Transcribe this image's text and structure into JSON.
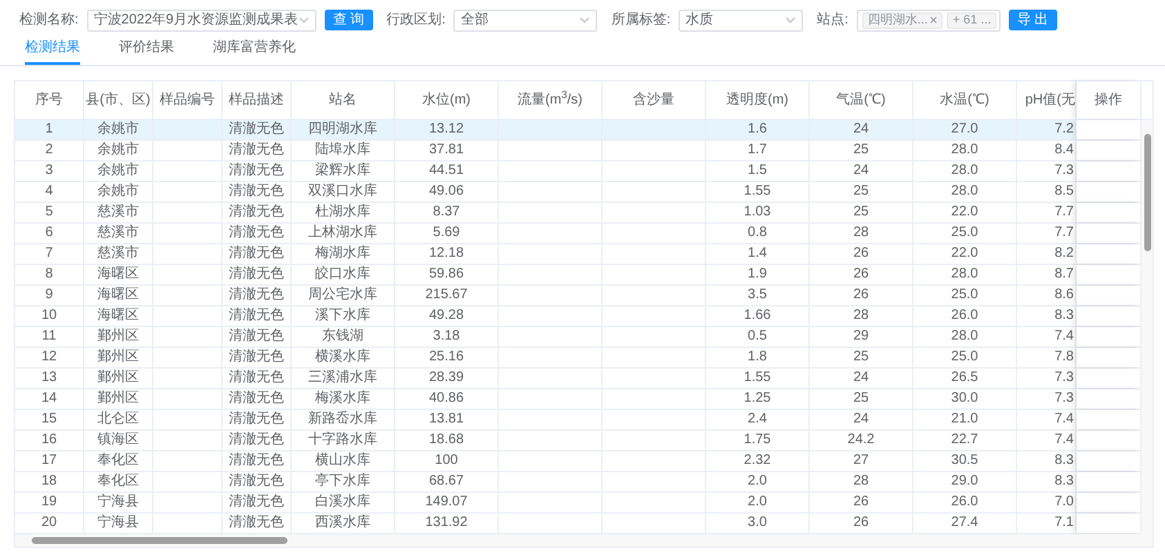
{
  "filters": [
    {
      "kind": "select",
      "label": "检测名称:",
      "value": "宁波2022年9月水资源监测成果表"
    },
    {
      "kind": "button",
      "label": "查 询"
    },
    {
      "kind": "select",
      "label": "行政区划:",
      "value": "全部"
    },
    {
      "kind": "select",
      "label": "所属标签:",
      "value": "水质"
    },
    {
      "kind": "tags",
      "label": "站点:",
      "tags": [
        {
          "text": "四明湖水...",
          "removable": true
        },
        {
          "text": "+ 61 ...",
          "removable": false
        }
      ]
    },
    {
      "kind": "button",
      "label": "导 出"
    }
  ],
  "tabs": [
    {
      "label": "检测结果",
      "selected": true
    },
    {
      "label": "评价结果",
      "selected": false
    },
    {
      "label": "湖库富营养化",
      "selected": false
    }
  ],
  "table": {
    "columns": [
      "序号",
      "县(市、区)",
      "样品编号",
      "样品描述",
      "站名",
      "水位(m)",
      "流量(m$^{3}$/s)",
      "含沙量",
      "透明度(m)",
      "气温(℃)",
      "水温(℃)",
      "pH值(无",
      "操作"
    ],
    "rows": [
      {
        "no": "1",
        "county": "余姚市",
        "desc": "清澈无色",
        "station": "四明湖水库",
        "level": "13.12",
        "clarity": "1.6",
        "air": "24",
        "water": "27.0",
        "ph": "7.2",
        "selected": true
      },
      {
        "no": "2",
        "county": "余姚市",
        "desc": "清澈无色",
        "station": "陆埠水库",
        "level": "37.81",
        "clarity": "1.7",
        "air": "25",
        "water": "28.0",
        "ph": "8.4",
        "selected": false
      },
      {
        "no": "3",
        "county": "余姚市",
        "desc": "清澈无色",
        "station": "梁辉水库",
        "level": "44.51",
        "clarity": "1.5",
        "air": "24",
        "water": "28.0",
        "ph": "7.3",
        "selected": false
      },
      {
        "no": "4",
        "county": "余姚市",
        "desc": "清澈无色",
        "station": "双溪口水库",
        "level": "49.06",
        "clarity": "1.55",
        "air": "25",
        "water": "28.0",
        "ph": "8.5",
        "selected": false
      },
      {
        "no": "5",
        "county": "慈溪市",
        "desc": "清澈无色",
        "station": "杜湖水库",
        "level": "8.37",
        "clarity": "1.03",
        "air": "25",
        "water": "22.0",
        "ph": "7.7",
        "selected": false
      },
      {
        "no": "6",
        "county": "慈溪市",
        "desc": "清澈无色",
        "station": "上林湖水库",
        "level": "5.69",
        "clarity": "0.8",
        "air": "28",
        "water": "25.0",
        "ph": "7.7",
        "selected": false
      },
      {
        "no": "7",
        "county": "慈溪市",
        "desc": "清澈无色",
        "station": "梅湖水库",
        "level": "12.18",
        "clarity": "1.4",
        "air": "26",
        "water": "22.0",
        "ph": "8.2",
        "selected": false
      },
      {
        "no": "8",
        "county": "海曙区",
        "desc": "清澈无色",
        "station": "皎口水库",
        "level": "59.86",
        "clarity": "1.9",
        "air": "26",
        "water": "28.0",
        "ph": "8.7",
        "selected": false
      },
      {
        "no": "9",
        "county": "海曙区",
        "desc": "清澈无色",
        "station": "周公宅水库",
        "level": "215.67",
        "clarity": "3.5",
        "air": "26",
        "water": "25.0",
        "ph": "8.6",
        "selected": false
      },
      {
        "no": "10",
        "county": "海曙区",
        "desc": "清澈无色",
        "station": "溪下水库",
        "level": "49.28",
        "clarity": "1.66",
        "air": "28",
        "water": "26.0",
        "ph": "8.3",
        "selected": false
      },
      {
        "no": "11",
        "county": "鄞州区",
        "desc": "清澈无色",
        "station": "东钱湖",
        "level": "3.18",
        "clarity": "0.5",
        "air": "29",
        "water": "28.0",
        "ph": "7.4",
        "selected": false
      },
      {
        "no": "12",
        "county": "鄞州区",
        "desc": "清澈无色",
        "station": "横溪水库",
        "level": "25.16",
        "clarity": "1.8",
        "air": "25",
        "water": "25.0",
        "ph": "7.8",
        "selected": false
      },
      {
        "no": "13",
        "county": "鄞州区",
        "desc": "清澈无色",
        "station": "三溪浦水库",
        "level": "28.39",
        "clarity": "1.55",
        "air": "24",
        "water": "26.5",
        "ph": "7.3",
        "selected": false
      },
      {
        "no": "14",
        "county": "鄞州区",
        "desc": "清澈无色",
        "station": "梅溪水库",
        "level": "40.86",
        "clarity": "1.25",
        "air": "25",
        "water": "30.0",
        "ph": "7.3",
        "selected": false
      },
      {
        "no": "15",
        "county": "北仑区",
        "desc": "清澈无色",
        "station": "新路岙水库",
        "level": "13.81",
        "clarity": "2.4",
        "air": "24",
        "water": "21.0",
        "ph": "7.4",
        "selected": false
      },
      {
        "no": "16",
        "county": "镇海区",
        "desc": "清澈无色",
        "station": "十字路水库",
        "level": "18.68",
        "clarity": "1.75",
        "air": "24.2",
        "water": "22.7",
        "ph": "7.4",
        "selected": false
      },
      {
        "no": "17",
        "county": "奉化区",
        "desc": "清澈无色",
        "station": "横山水库",
        "level": "100",
        "clarity": "2.32",
        "air": "27",
        "water": "30.5",
        "ph": "8.3",
        "selected": false
      },
      {
        "no": "18",
        "county": "奉化区",
        "desc": "清澈无色",
        "station": "亭下水库",
        "level": "68.67",
        "clarity": "2.0",
        "air": "28",
        "water": "29.0",
        "ph": "8.3",
        "selected": false
      },
      {
        "no": "19",
        "county": "宁海县",
        "desc": "清澈无色",
        "station": "白溪水库",
        "level": "149.07",
        "clarity": "2.0",
        "air": "26",
        "water": "26.0",
        "ph": "7.0",
        "selected": false
      },
      {
        "no": "20",
        "county": "宁海县",
        "desc": "清澈无色",
        "station": "西溪水库",
        "level": "131.92",
        "clarity": "3.0",
        "air": "26",
        "water": "27.4",
        "ph": "7.1",
        "selected": false
      }
    ]
  }
}
